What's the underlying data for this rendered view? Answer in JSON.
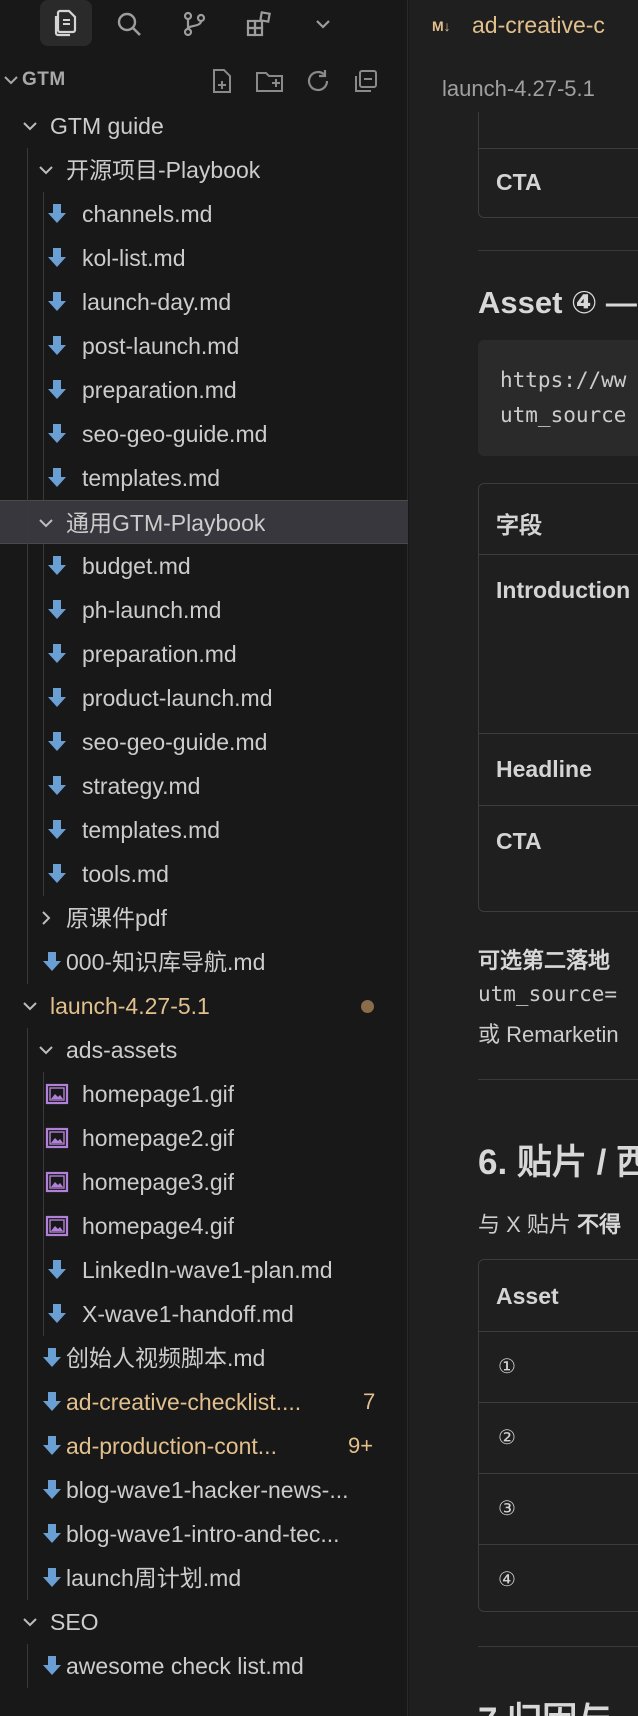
{
  "activity_bar": {
    "icons": [
      "explorer-icon",
      "search-icon",
      "source-control-icon",
      "extensions-icon",
      "chevron-down-icon"
    ]
  },
  "explorer": {
    "section_title": "GTM",
    "header_actions": [
      "new-file-icon",
      "new-folder-icon",
      "refresh-icon",
      "collapse-all-icon"
    ],
    "tree": [
      {
        "label": "GTM guide",
        "type": "folder",
        "open": true,
        "depth": 0
      },
      {
        "label": "开源项目-Playbook",
        "type": "folder",
        "open": true,
        "depth": 1
      },
      {
        "label": "channels.md",
        "type": "md",
        "depth": 2
      },
      {
        "label": "kol-list.md",
        "type": "md",
        "depth": 2
      },
      {
        "label": "launch-day.md",
        "type": "md",
        "depth": 2
      },
      {
        "label": "post-launch.md",
        "type": "md",
        "depth": 2
      },
      {
        "label": "preparation.md",
        "type": "md",
        "depth": 2
      },
      {
        "label": "seo-geo-guide.md",
        "type": "md",
        "depth": 2
      },
      {
        "label": "templates.md",
        "type": "md",
        "depth": 2
      },
      {
        "label": "通用GTM-Playbook",
        "type": "folder",
        "open": true,
        "depth": 1,
        "selected": true
      },
      {
        "label": "budget.md",
        "type": "md",
        "depth": 2
      },
      {
        "label": "ph-launch.md",
        "type": "md",
        "depth": 2
      },
      {
        "label": "preparation.md",
        "type": "md",
        "depth": 2
      },
      {
        "label": "product-launch.md",
        "type": "md",
        "depth": 2
      },
      {
        "label": "seo-geo-guide.md",
        "type": "md",
        "depth": 2
      },
      {
        "label": "strategy.md",
        "type": "md",
        "depth": 2
      },
      {
        "label": "templates.md",
        "type": "md",
        "depth": 2
      },
      {
        "label": "tools.md",
        "type": "md",
        "depth": 2
      },
      {
        "label": "原课件pdf",
        "type": "folder",
        "open": false,
        "depth": 1
      },
      {
        "label": "000-知识库导航.md",
        "type": "md",
        "depth": 1
      },
      {
        "label": "launch-4.27-5.1",
        "type": "folder",
        "open": true,
        "depth": 0,
        "modified": true,
        "dot": true
      },
      {
        "label": "ads-assets",
        "type": "folder",
        "open": true,
        "depth": 1
      },
      {
        "label": "homepage1.gif",
        "type": "img",
        "depth": 2
      },
      {
        "label": "homepage2.gif",
        "type": "img",
        "depth": 2
      },
      {
        "label": "homepage3.gif",
        "type": "img",
        "depth": 2
      },
      {
        "label": "homepage4.gif",
        "type": "img",
        "depth": 2
      },
      {
        "label": "LinkedIn-wave1-plan.md",
        "type": "md",
        "depth": 2
      },
      {
        "label": "X-wave1-handoff.md",
        "type": "md",
        "depth": 2
      },
      {
        "label": "创始人视频脚本.md",
        "type": "md",
        "depth": 1
      },
      {
        "label": "ad-creative-checklist....",
        "type": "md",
        "depth": 1,
        "modified": true,
        "badge": "7"
      },
      {
        "label": "ad-production-cont...",
        "type": "md",
        "depth": 1,
        "modified": true,
        "badge": "9+"
      },
      {
        "label": "blog-wave1-hacker-news-...",
        "type": "md",
        "depth": 1
      },
      {
        "label": "blog-wave1-intro-and-tec...",
        "type": "md",
        "depth": 1
      },
      {
        "label": "launch周计划.md",
        "type": "md",
        "depth": 1
      },
      {
        "label": "SEO",
        "type": "folder",
        "open": true,
        "depth": 0
      },
      {
        "label": "awesome check list.md",
        "type": "md",
        "depth": 1
      }
    ]
  },
  "editor": {
    "tab": {
      "md_glyph": "M↓",
      "title": "ad-creative-c"
    },
    "breadcrumb": "launch-4.27-5.1",
    "top_table_row": "CTA",
    "asset4_heading": "Asset ④ —",
    "code_lines": [
      "https://ww",
      "utm_source"
    ],
    "table2": [
      "字段",
      "Introduction",
      "Headline",
      "CTA"
    ],
    "optional_bold": "可选第二落地",
    "optional_code": "utm_source=",
    "optional_text": "或 Remarketin",
    "section6_heading": "6. 贴片 / 西",
    "section6_sub_prefix": "与 X 贴片 ",
    "section6_sub_bold": "不得",
    "table3": [
      "Asset",
      "①",
      "②",
      "③",
      "④"
    ],
    "section7_heading": "7 归因与"
  },
  "colors": {
    "background": "#181818",
    "editor_bg": "#1f1f1f",
    "modified": "#e2c08d",
    "md_icon": "#6a9fd4",
    "image_icon": "#b180d7",
    "dot": "#8a6b4a"
  }
}
